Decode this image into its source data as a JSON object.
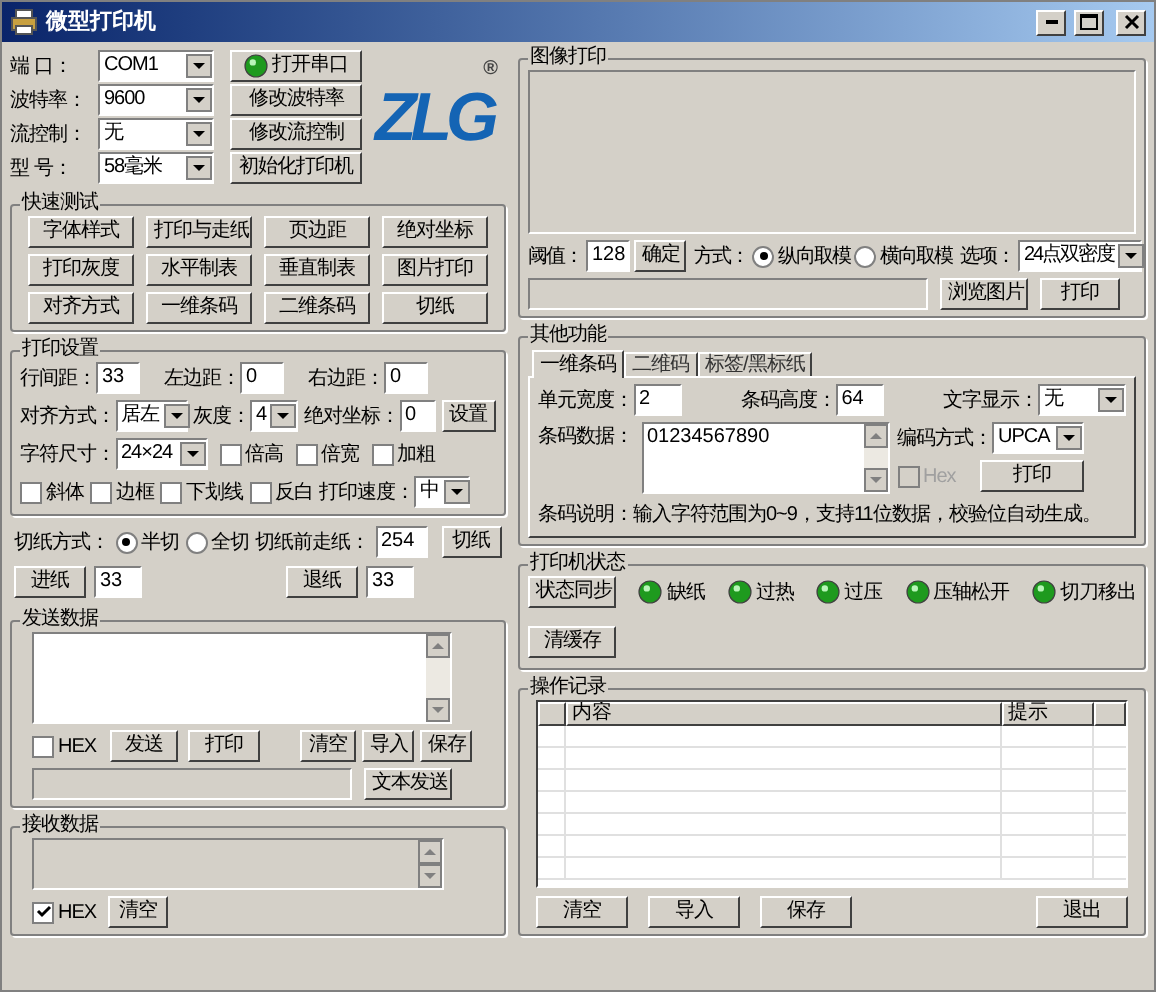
{
  "window": {
    "title": "微型打印机"
  },
  "serial": {
    "indicator_on": true,
    "rows": [
      {
        "label": "端 口：",
        "value": "COM1",
        "button": "打开串口"
      },
      {
        "label": "波特率：",
        "value": "9600",
        "button": "修改波特率"
      },
      {
        "label": "流控制：",
        "value": "无",
        "button": "修改流控制"
      },
      {
        "label": "型 号：",
        "value": "58毫米",
        "button": "初始化打印机"
      }
    ]
  },
  "logo": {
    "text": "ZLG",
    "mark": "®"
  },
  "quick_test": {
    "title": "快速测试",
    "buttons": [
      "字体样式",
      "打印与走纸",
      "页边距",
      "绝对坐标",
      "打印灰度",
      "水平制表",
      "垂直制表",
      "图片打印",
      "对齐方式",
      "一维条码",
      "二维条码",
      "切纸"
    ]
  },
  "print_settings": {
    "title": "打印设置",
    "line_spacing": {
      "label": "行间距：",
      "value": "33"
    },
    "left_margin": {
      "label": "左边距：",
      "value": "0"
    },
    "right_margin": {
      "label": "右边距：",
      "value": "0"
    },
    "align": {
      "label": "对齐方式：",
      "value": "居左"
    },
    "gray": {
      "label": "灰度：",
      "value": "4"
    },
    "abs_pos": {
      "label": "绝对坐标：",
      "value": "0"
    },
    "set_button": "设置",
    "char_size": {
      "label": "字符尺寸：",
      "value": "24×24"
    },
    "styles": [
      {
        "label": "倍高",
        "checked": false
      },
      {
        "label": "倍宽",
        "checked": false
      },
      {
        "label": "加粗",
        "checked": false
      },
      {
        "label": "斜体",
        "checked": false
      },
      {
        "label": "边框",
        "checked": false
      },
      {
        "label": "下划线",
        "checked": false
      },
      {
        "label": "反白",
        "checked": false
      }
    ],
    "speed": {
      "label": "打印速度：",
      "value": "中"
    }
  },
  "cut": {
    "label": "切纸方式：",
    "options": [
      {
        "label": "半切",
        "selected": true
      },
      {
        "label": "全切",
        "selected": false
      }
    ],
    "feed_label": "切纸前走纸：",
    "feed_value": "254",
    "button": "切纸"
  },
  "feed": [
    {
      "button": "进纸",
      "value": "33"
    },
    {
      "button": "退纸",
      "value": "33"
    }
  ],
  "send": {
    "title": "发送数据",
    "hex": {
      "label": "HEX",
      "checked": false
    },
    "buttons": [
      "发送",
      "打印",
      "清空",
      "导入",
      "保存"
    ],
    "text_button": "文本发送"
  },
  "receive": {
    "title": "接收数据",
    "hex": {
      "label": "HEX",
      "checked": true
    },
    "button": "清空"
  },
  "image_print": {
    "title": "图像打印",
    "threshold_label": "阈值：",
    "threshold": "128",
    "confirm": "确定",
    "mode_label": "方式：",
    "modes": [
      {
        "label": "纵向取模",
        "selected": true
      },
      {
        "label": "横向取模",
        "selected": false
      }
    ],
    "option_label": "选项：",
    "option": "24点双密度",
    "buttons": [
      "浏览图片",
      "打印"
    ]
  },
  "other": {
    "title": "其他功能",
    "tabs": [
      {
        "label": "一维条码",
        "selected": true
      },
      {
        "label": "二维码",
        "selected": false
      },
      {
        "label": "标签/黑标纸",
        "selected": false
      }
    ],
    "unit_width": {
      "label": "单元宽度：",
      "value": "2"
    },
    "bar_height": {
      "label": "条码高度：",
      "value": "64"
    },
    "text_display": {
      "label": "文字显示：",
      "value": "无"
    },
    "data": {
      "label": "条码数据：",
      "value": "01234567890"
    },
    "encoding": {
      "label": "编码方式：",
      "value": "UPCA"
    },
    "hex": {
      "label": "Hex",
      "checked": false,
      "disabled": true
    },
    "print_button": "打印",
    "note_label": "条码说明：",
    "note": "输入字符范围为0~9，支持11位数据，校验位自动生成。"
  },
  "status": {
    "title": "打印机状态",
    "sync_button": "状态同步",
    "clear_button": "清缓存",
    "indicators": [
      {
        "label": "缺纸",
        "on": true
      },
      {
        "label": "过热",
        "on": true
      },
      {
        "label": "过压",
        "on": true
      },
      {
        "label": "压轴松开",
        "on": true
      },
      {
        "label": "切刀移出",
        "on": true
      }
    ]
  },
  "log": {
    "title": "操作记录",
    "columns": [
      "内容",
      "提示"
    ],
    "buttons": [
      "清空",
      "导入",
      "保存",
      "退出"
    ]
  }
}
